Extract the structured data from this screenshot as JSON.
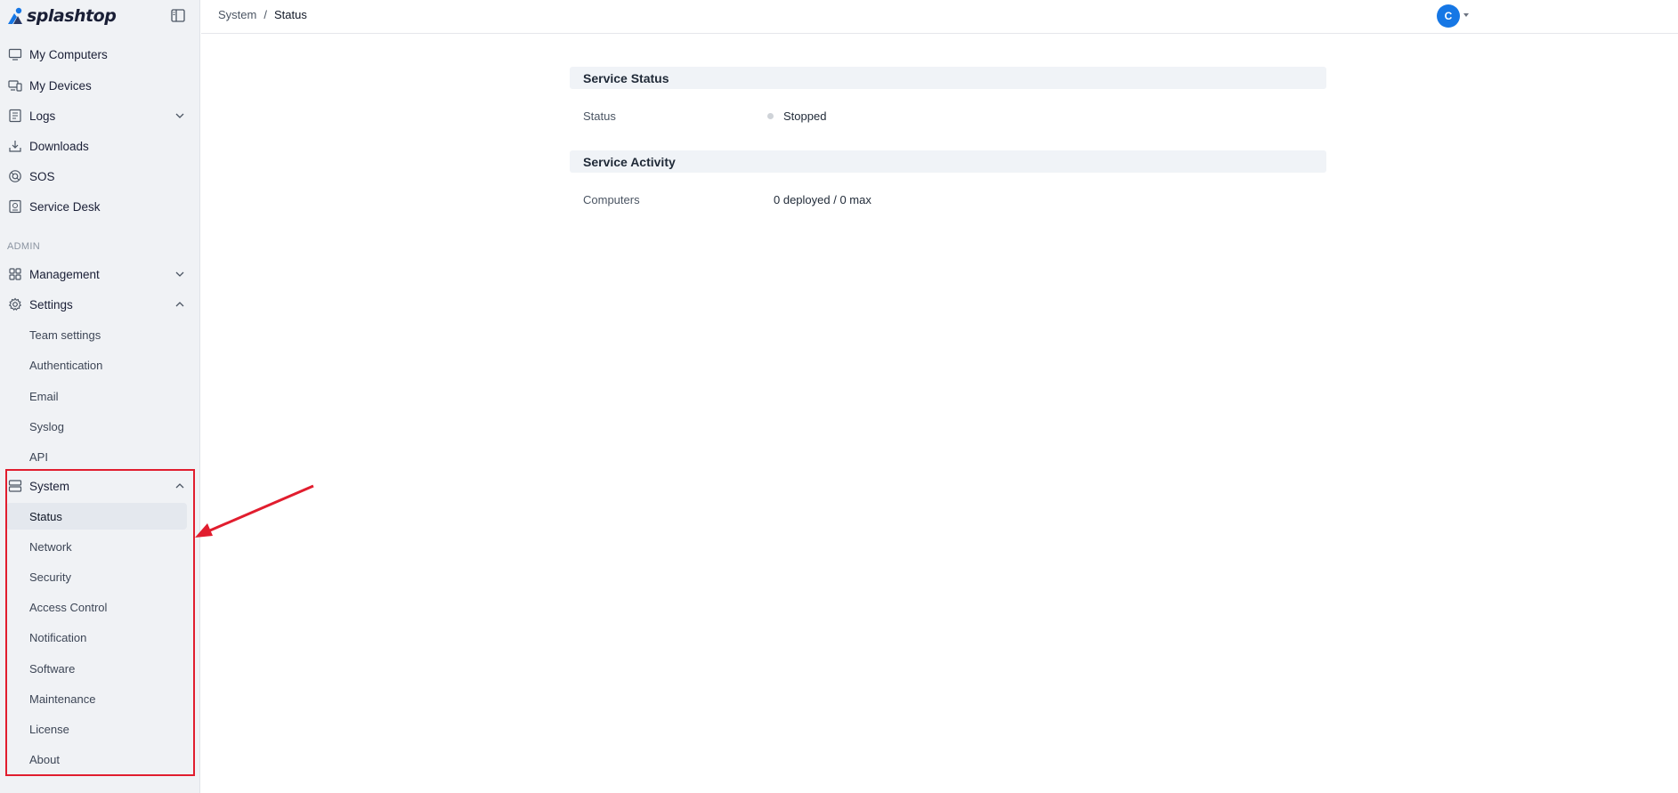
{
  "brand": {
    "name": "splashtop"
  },
  "sidebar": {
    "items": [
      {
        "label": "My Computers",
        "icon": "monitor-icon"
      },
      {
        "label": "My Devices",
        "icon": "devices-icon"
      },
      {
        "label": "Logs",
        "icon": "logs-icon",
        "expandable": true
      },
      {
        "label": "Downloads",
        "icon": "download-icon"
      },
      {
        "label": "SOS",
        "icon": "sos-icon"
      },
      {
        "label": "Service Desk",
        "icon": "service-desk-icon"
      }
    ],
    "admin_section_label": "ADMIN",
    "admin_items": [
      {
        "label": "Management",
        "icon": "grid-icon",
        "expanded": false
      },
      {
        "label": "Settings",
        "icon": "gear-icon",
        "expanded": true
      }
    ],
    "settings_sub": [
      "Team settings",
      "Authentication",
      "Email",
      "Syslog",
      "API"
    ],
    "system": {
      "label": "System",
      "icon": "server-icon",
      "expanded": true
    },
    "system_sub": [
      "Status",
      "Network",
      "Security",
      "Access Control",
      "Notification",
      "Software",
      "Maintenance",
      "License",
      "About"
    ],
    "active_item": "Status"
  },
  "breadcrumb": {
    "parent": "System",
    "separator": "/",
    "current": "Status"
  },
  "user": {
    "initial": "C",
    "avatar_color": "#1677e5"
  },
  "main": {
    "service_status": {
      "title": "Service Status",
      "status_label": "Status",
      "status_value": "Stopped"
    },
    "service_activity": {
      "title": "Service Activity",
      "computers_label": "Computers",
      "computers_value": "0 deployed / 0 max"
    }
  },
  "colors": {
    "accent": "#1677e5",
    "highlight": "#e11d2e",
    "sidebar_bg": "#f0f2f5",
    "status_dot": "#cfd3d8"
  }
}
